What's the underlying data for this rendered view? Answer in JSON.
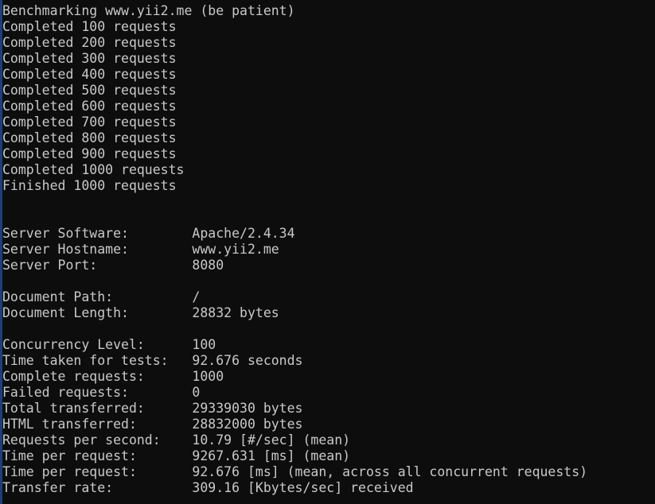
{
  "terminal": {
    "background_color": "#0d0d0d",
    "foreground_color": "#c9c9c9",
    "edge_marker_color": "#1d3f73",
    "columns": 82,
    "rows": 32
  },
  "output": {
    "header_line": "Benchmarking www.yii2.me (be patient)",
    "progress_lines": [
      "Completed 100 requests",
      "Completed 200 requests",
      "Completed 300 requests",
      "Completed 400 requests",
      "Completed 500 requests",
      "Completed 600 requests",
      "Completed 700 requests",
      "Completed 800 requests",
      "Completed 900 requests",
      "Completed 1000 requests",
      "Finished 1000 requests"
    ],
    "server_block": [
      {
        "label": "Server Software:",
        "value": "Apache/2.4.34"
      },
      {
        "label": "Server Hostname:",
        "value": "www.yii2.me"
      },
      {
        "label": "Server Port:",
        "value": "8080"
      }
    ],
    "document_block": [
      {
        "label": "Document Path:",
        "value": "/"
      },
      {
        "label": "Document Length:",
        "value": "28832 bytes"
      }
    ],
    "stats_block": [
      {
        "label": "Concurrency Level:",
        "value": "100"
      },
      {
        "label": "Time taken for tests:",
        "value": "92.676 seconds"
      },
      {
        "label": "Complete requests:",
        "value": "1000"
      },
      {
        "label": "Failed requests:",
        "value": "0"
      },
      {
        "label": "Total transferred:",
        "value": "29339030 bytes"
      },
      {
        "label": "HTML transferred:",
        "value": "28832000 bytes"
      },
      {
        "label": "Requests per second:",
        "value": "10.79 [#/sec] (mean)"
      },
      {
        "label": "Time per request:",
        "value": "9267.631 [ms] (mean)"
      },
      {
        "label": "Time per request:",
        "value": "92.676 [ms] (mean, across all concurrent requests)"
      },
      {
        "label": "Transfer rate:",
        "value": "309.16 [Kbytes/sec] received"
      }
    ]
  }
}
